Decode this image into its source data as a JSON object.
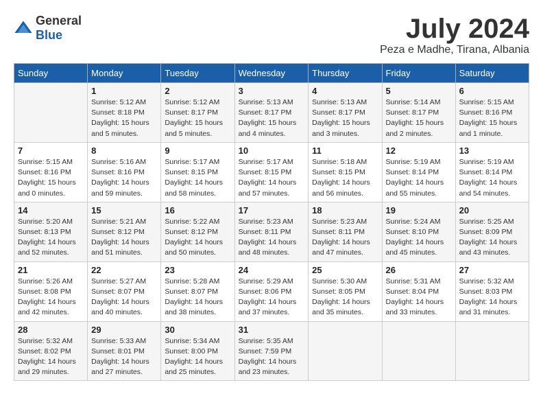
{
  "logo": {
    "general": "General",
    "blue": "Blue"
  },
  "title": "July 2024",
  "location": "Peza e Madhe, Tirana, Albania",
  "days_of_week": [
    "Sunday",
    "Monday",
    "Tuesday",
    "Wednesday",
    "Thursday",
    "Friday",
    "Saturday"
  ],
  "weeks": [
    [
      {
        "day": "",
        "info": ""
      },
      {
        "day": "1",
        "info": "Sunrise: 5:12 AM\nSunset: 8:18 PM\nDaylight: 15 hours\nand 5 minutes."
      },
      {
        "day": "2",
        "info": "Sunrise: 5:12 AM\nSunset: 8:17 PM\nDaylight: 15 hours\nand 5 minutes."
      },
      {
        "day": "3",
        "info": "Sunrise: 5:13 AM\nSunset: 8:17 PM\nDaylight: 15 hours\nand 4 minutes."
      },
      {
        "day": "4",
        "info": "Sunrise: 5:13 AM\nSunset: 8:17 PM\nDaylight: 15 hours\nand 3 minutes."
      },
      {
        "day": "5",
        "info": "Sunrise: 5:14 AM\nSunset: 8:17 PM\nDaylight: 15 hours\nand 2 minutes."
      },
      {
        "day": "6",
        "info": "Sunrise: 5:15 AM\nSunset: 8:16 PM\nDaylight: 15 hours\nand 1 minute."
      }
    ],
    [
      {
        "day": "7",
        "info": "Sunrise: 5:15 AM\nSunset: 8:16 PM\nDaylight: 15 hours\nand 0 minutes."
      },
      {
        "day": "8",
        "info": "Sunrise: 5:16 AM\nSunset: 8:16 PM\nDaylight: 14 hours\nand 59 minutes."
      },
      {
        "day": "9",
        "info": "Sunrise: 5:17 AM\nSunset: 8:15 PM\nDaylight: 14 hours\nand 58 minutes."
      },
      {
        "day": "10",
        "info": "Sunrise: 5:17 AM\nSunset: 8:15 PM\nDaylight: 14 hours\nand 57 minutes."
      },
      {
        "day": "11",
        "info": "Sunrise: 5:18 AM\nSunset: 8:15 PM\nDaylight: 14 hours\nand 56 minutes."
      },
      {
        "day": "12",
        "info": "Sunrise: 5:19 AM\nSunset: 8:14 PM\nDaylight: 14 hours\nand 55 minutes."
      },
      {
        "day": "13",
        "info": "Sunrise: 5:19 AM\nSunset: 8:14 PM\nDaylight: 14 hours\nand 54 minutes."
      }
    ],
    [
      {
        "day": "14",
        "info": "Sunrise: 5:20 AM\nSunset: 8:13 PM\nDaylight: 14 hours\nand 52 minutes."
      },
      {
        "day": "15",
        "info": "Sunrise: 5:21 AM\nSunset: 8:12 PM\nDaylight: 14 hours\nand 51 minutes."
      },
      {
        "day": "16",
        "info": "Sunrise: 5:22 AM\nSunset: 8:12 PM\nDaylight: 14 hours\nand 50 minutes."
      },
      {
        "day": "17",
        "info": "Sunrise: 5:23 AM\nSunset: 8:11 PM\nDaylight: 14 hours\nand 48 minutes."
      },
      {
        "day": "18",
        "info": "Sunrise: 5:23 AM\nSunset: 8:11 PM\nDaylight: 14 hours\nand 47 minutes."
      },
      {
        "day": "19",
        "info": "Sunrise: 5:24 AM\nSunset: 8:10 PM\nDaylight: 14 hours\nand 45 minutes."
      },
      {
        "day": "20",
        "info": "Sunrise: 5:25 AM\nSunset: 8:09 PM\nDaylight: 14 hours\nand 43 minutes."
      }
    ],
    [
      {
        "day": "21",
        "info": "Sunrise: 5:26 AM\nSunset: 8:08 PM\nDaylight: 14 hours\nand 42 minutes."
      },
      {
        "day": "22",
        "info": "Sunrise: 5:27 AM\nSunset: 8:07 PM\nDaylight: 14 hours\nand 40 minutes."
      },
      {
        "day": "23",
        "info": "Sunrise: 5:28 AM\nSunset: 8:07 PM\nDaylight: 14 hours\nand 38 minutes."
      },
      {
        "day": "24",
        "info": "Sunrise: 5:29 AM\nSunset: 8:06 PM\nDaylight: 14 hours\nand 37 minutes."
      },
      {
        "day": "25",
        "info": "Sunrise: 5:30 AM\nSunset: 8:05 PM\nDaylight: 14 hours\nand 35 minutes."
      },
      {
        "day": "26",
        "info": "Sunrise: 5:31 AM\nSunset: 8:04 PM\nDaylight: 14 hours\nand 33 minutes."
      },
      {
        "day": "27",
        "info": "Sunrise: 5:32 AM\nSunset: 8:03 PM\nDaylight: 14 hours\nand 31 minutes."
      }
    ],
    [
      {
        "day": "28",
        "info": "Sunrise: 5:32 AM\nSunset: 8:02 PM\nDaylight: 14 hours\nand 29 minutes."
      },
      {
        "day": "29",
        "info": "Sunrise: 5:33 AM\nSunset: 8:01 PM\nDaylight: 14 hours\nand 27 minutes."
      },
      {
        "day": "30",
        "info": "Sunrise: 5:34 AM\nSunset: 8:00 PM\nDaylight: 14 hours\nand 25 minutes."
      },
      {
        "day": "31",
        "info": "Sunrise: 5:35 AM\nSunset: 7:59 PM\nDaylight: 14 hours\nand 23 minutes."
      },
      {
        "day": "",
        "info": ""
      },
      {
        "day": "",
        "info": ""
      },
      {
        "day": "",
        "info": ""
      }
    ]
  ]
}
